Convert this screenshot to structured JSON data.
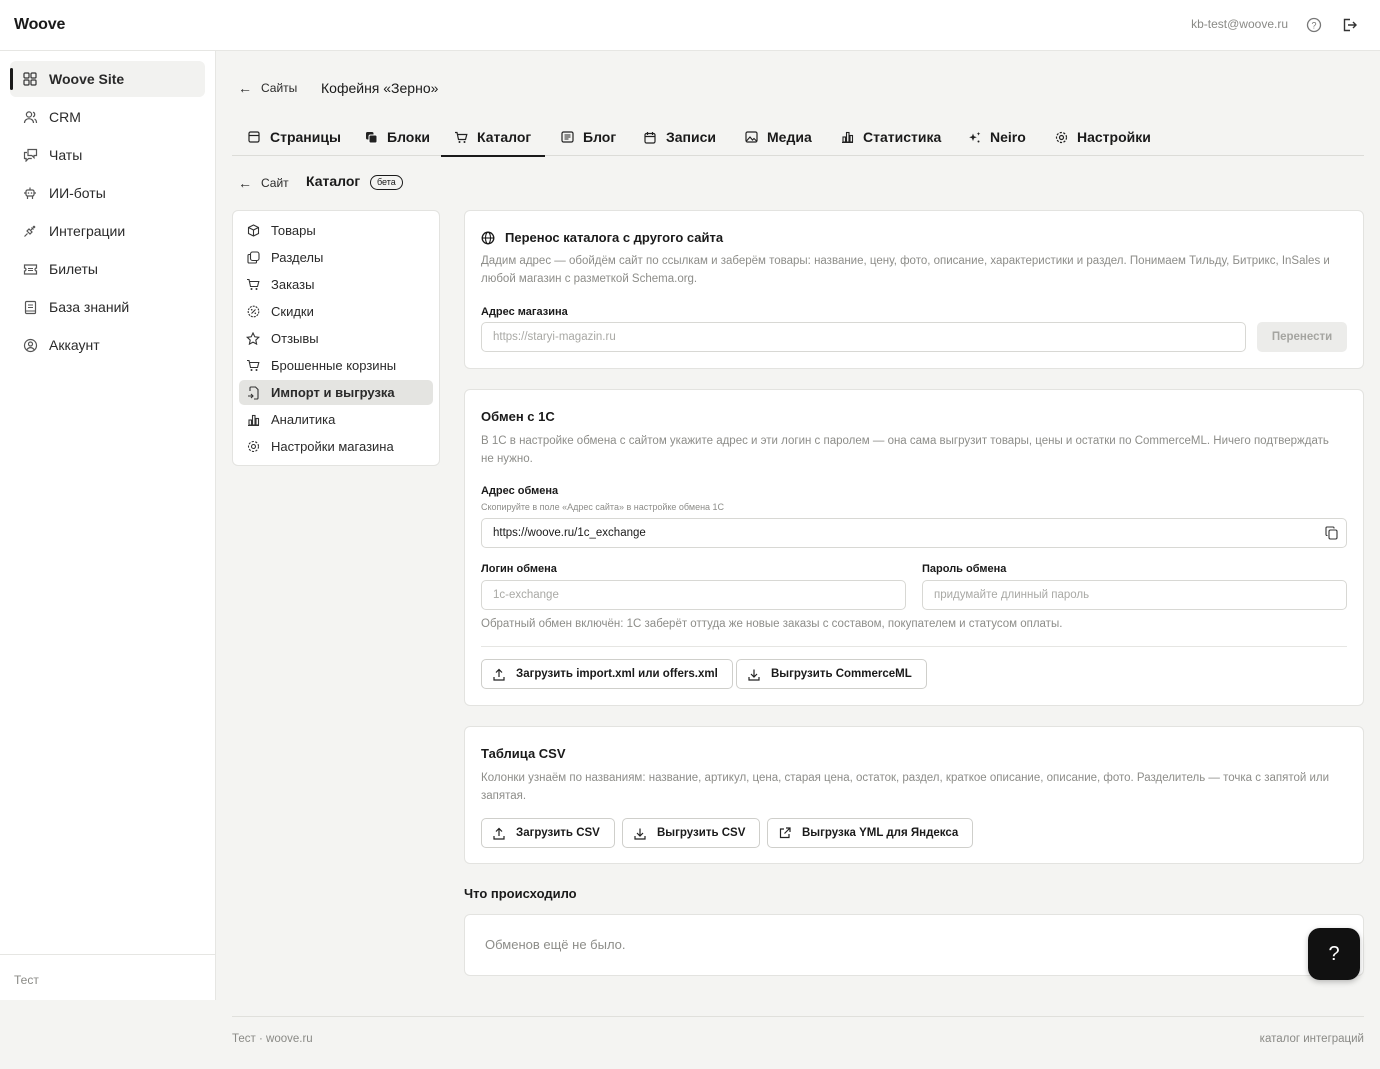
{
  "app": {
    "logo": "Woove",
    "user_email": "kb-test@woove.ru"
  },
  "sidebar": {
    "items": [
      {
        "label": "Woove Site",
        "icon": "grid-icon"
      },
      {
        "label": "CRM",
        "icon": "users-icon"
      },
      {
        "label": "Чаты",
        "icon": "chat-icon"
      },
      {
        "label": "ИИ-боты",
        "icon": "bot-icon"
      },
      {
        "label": "Интеграции",
        "icon": "plug-icon"
      },
      {
        "label": "Билеты",
        "icon": "ticket-icon"
      },
      {
        "label": "База знаний",
        "icon": "book-icon"
      },
      {
        "label": "Аккаунт",
        "icon": "account-icon"
      }
    ],
    "footer": "Тест"
  },
  "breadcrumb": {
    "back_label": "Сайты",
    "site_name": "Кофейня «Зерно»"
  },
  "tabs": [
    {
      "label": "Страницы",
      "icon": "page-icon"
    },
    {
      "label": "Блоки",
      "icon": "blocks-icon"
    },
    {
      "label": "Каталог",
      "icon": "cart-icon"
    },
    {
      "label": "Блог",
      "icon": "blog-icon"
    },
    {
      "label": "Записи",
      "icon": "calendar-icon"
    },
    {
      "label": "Медиа",
      "icon": "image-icon"
    },
    {
      "label": "Статистика",
      "icon": "chart-icon"
    },
    {
      "label": "Neiro",
      "icon": "sparkle-icon"
    },
    {
      "label": "Настройки",
      "icon": "gear-icon"
    }
  ],
  "section": {
    "back_label": "Сайт",
    "title": "Каталог",
    "badge": "бета"
  },
  "subnav": [
    {
      "label": "Товары",
      "icon": "box-icon"
    },
    {
      "label": "Разделы",
      "icon": "folders-icon"
    },
    {
      "label": "Заказы",
      "icon": "cart-icon"
    },
    {
      "label": "Скидки",
      "icon": "discount-icon"
    },
    {
      "label": "Отзывы",
      "icon": "star-icon"
    },
    {
      "label": "Брошенные корзины",
      "icon": "cart-icon"
    },
    {
      "label": "Импорт и выгрузка",
      "icon": "import-icon"
    },
    {
      "label": "Аналитика",
      "icon": "chart-icon"
    },
    {
      "label": "Настройки магазина",
      "icon": "gear-icon"
    }
  ],
  "migration": {
    "title": "Перенос каталога с другого сайта",
    "description": "Дадим адрес — обойдём сайт по ссылкам и заберём товары: название, цену, фото, описание, характеристики и раздел. Понимаем Тильду, Битрикс, InSales и любой магазин с разметкой Schema.org.",
    "address_label": "Адрес магазина",
    "address_placeholder": "https://staryi-magazin.ru",
    "button": "Перенести"
  },
  "exchange": {
    "title": "Обмен с 1С",
    "description": "В 1С в настройке обмена с сайтом укажите адрес и эти логин с паролем — она сама выгрузит товары, цены и остатки по CommerceML. Ничего подтверждать не нужно.",
    "address_label": "Адрес обмена",
    "address_hint": "Скопируйте в поле «Адрес сайта» в настройке обмена 1С",
    "address_value": "https://woove.ru/1c_exchange",
    "login_label": "Логин обмена",
    "login_placeholder": "1c-exchange",
    "password_label": "Пароль обмена",
    "password_placeholder": "придумайте длинный пароль",
    "note": "Обратный обмен включён: 1С заберёт оттуда же новые заказы с составом, покупателем и статусом оплаты.",
    "upload_button": "Загрузить import.xml или offers.xml",
    "download_button": "Выгрузить CommerceML"
  },
  "csv": {
    "title": "Таблица CSV",
    "description": "Колонки узнаём по названиям: название, артикул, цена, старая цена, остаток, раздел, краткое описание, описание, фото. Разделитель — точка с запятой или запятая.",
    "upload_button": "Загрузить CSV",
    "download_button": "Выгрузить CSV",
    "yml_button": "Выгрузка YML для Яндекса"
  },
  "history": {
    "title": "Что происходило",
    "empty": "Обменов ещё не было."
  },
  "help_button": "?",
  "footer": {
    "left": "Тест · woove.ru",
    "right": "каталог интеграций"
  }
}
